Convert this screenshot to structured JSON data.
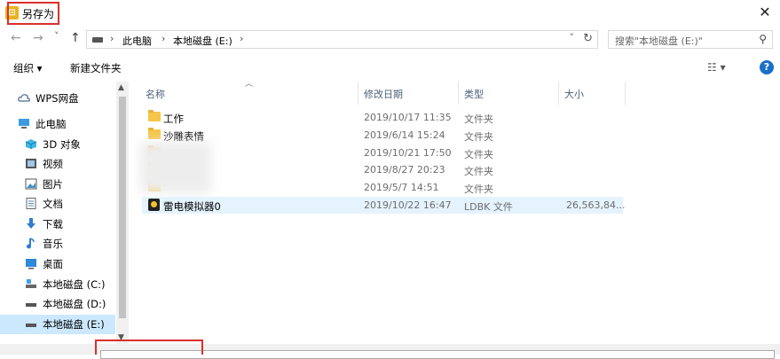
{
  "window": {
    "title": "另存为",
    "close_glyph": "✕"
  },
  "nav_buttons": {
    "back": "←",
    "forward": "→",
    "recent": "˅",
    "up": "↑"
  },
  "address": {
    "separator": "›",
    "crumbs": [
      "此电脑",
      "本地磁盘 (E:)"
    ],
    "dropdown": "˅",
    "refresh": "↻"
  },
  "search": {
    "placeholder": "搜索\"本地磁盘 (E:)\"",
    "icon": "⚲"
  },
  "toolbar": {
    "organize": "组织 ▾",
    "new_folder": "新建文件夹",
    "view_icon": "☷ ▾",
    "help": "?"
  },
  "sidebar": {
    "items": [
      {
        "label": "WPS网盘",
        "icon": "cloud-icon"
      },
      {
        "label": "此电脑",
        "icon": "computer-icon"
      },
      {
        "label": "3D 对象",
        "icon": "cube-icon"
      },
      {
        "label": "视频",
        "icon": "video-icon"
      },
      {
        "label": "图片",
        "icon": "picture-icon"
      },
      {
        "label": "文档",
        "icon": "document-icon"
      },
      {
        "label": "下载",
        "icon": "download-icon"
      },
      {
        "label": "音乐",
        "icon": "music-icon"
      },
      {
        "label": "桌面",
        "icon": "desktop-icon"
      },
      {
        "label": "本地磁盘 (C:)",
        "icon": "drive-icon"
      },
      {
        "label": "本地磁盘 (D:)",
        "icon": "drive-icon"
      },
      {
        "label": "本地磁盘 (E:)",
        "icon": "drive-icon",
        "selected": true
      }
    ]
  },
  "columns": {
    "name": "名称",
    "modified": "修改日期",
    "type": "类型",
    "size": "大小"
  },
  "files": [
    {
      "name": "工作",
      "modified": "2019/10/17 11:35",
      "type": "文件夹",
      "size": "",
      "icon": "folder-icon"
    },
    {
      "name": "沙雕表情",
      "modified": "2019/6/14 15:24",
      "type": "文件夹",
      "size": "",
      "icon": "folder-icon"
    },
    {
      "name": "",
      "modified": "2019/10/21 17:50",
      "type": "文件夹",
      "size": "",
      "icon": "folder-icon"
    },
    {
      "name": "",
      "modified": "2019/8/27 20:23",
      "type": "文件夹",
      "size": "",
      "icon": "folder-icon"
    },
    {
      "name": "",
      "modified": "2019/5/7 14:51",
      "type": "文件夹",
      "size": "",
      "icon": "folder-icon"
    },
    {
      "name": "雷电模拟器0",
      "modified": "2019/10/22 16:47",
      "type": "LDBK 文件",
      "size": "26,563,84...",
      "icon": "ldbk-file-icon"
    }
  ]
}
